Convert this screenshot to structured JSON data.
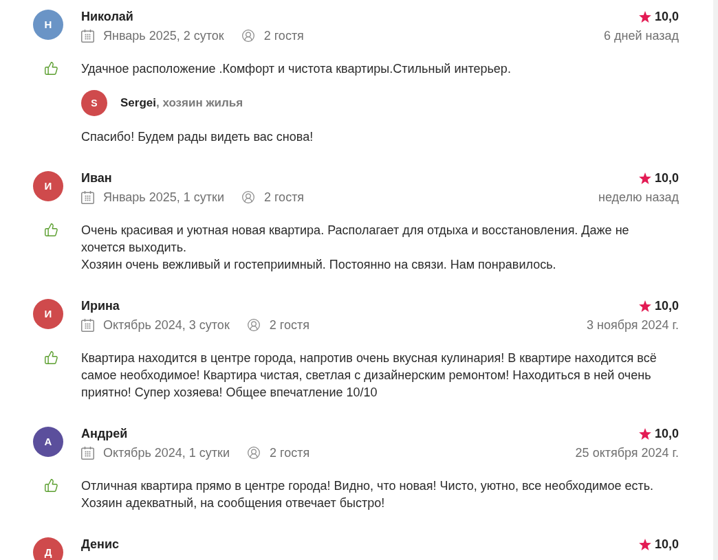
{
  "reviews": [
    {
      "initial": "Н",
      "color": "#6a94c6",
      "name": "Николай",
      "rating": "10,0",
      "stay": "Январь 2025, 2 суток",
      "guests": "2 гостя",
      "date": "6 дней назад",
      "text": "Удачное расположение .Комфорт и чистота квартиры.Стильный интерьер.",
      "reply": {
        "initial": "S",
        "color": "#cf4a4c",
        "author": "Sergei",
        "role": ", хозяин жилья",
        "text": "Спасибо! Будем рады видеть вас снова!"
      }
    },
    {
      "initial": "И",
      "color": "#cf4a4c",
      "name": "Иван",
      "rating": "10,0",
      "stay": "Январь 2025, 1 сутки",
      "guests": "2 гостя",
      "date": "неделю назад",
      "text": "Очень красивая и уютная новая квартира. Располагает для отдыха и восстановления. Даже не хочется выходить.\nХозяин очень вежливый и гостеприимный. Постоянно на связи. Нам понравилось."
    },
    {
      "initial": "И",
      "color": "#cf4a4c",
      "name": "Ирина",
      "rating": "10,0",
      "stay": "Октябрь 2024, 3 суток",
      "guests": "2 гостя",
      "date": "3 ноября 2024 г.",
      "text": "Квартира находится в центре города, напротив очень вкусная кулинария! В квартире находится всё самое необходимое! Квартира чистая, светлая с дизайнерским ремонтом! Находиться в ней очень приятно! Супер хозяева! Общее впечатление 10/10"
    },
    {
      "initial": "А",
      "color": "#5b4f9c",
      "name": "Андрей",
      "rating": "10,0",
      "stay": "Октябрь 2024, 1 сутки",
      "guests": "2 гостя",
      "date": "25 октября 2024 г.",
      "text": "Отличная квартира прямо в центре города! Видно, что новая! Чисто, уютно, все необходимое есть. Хозяин адекватный, на сообщения отвечает быстро!"
    },
    {
      "initial": "Д",
      "color": "#cf4a4c",
      "name": "Денис",
      "rating": "10,0"
    }
  ]
}
